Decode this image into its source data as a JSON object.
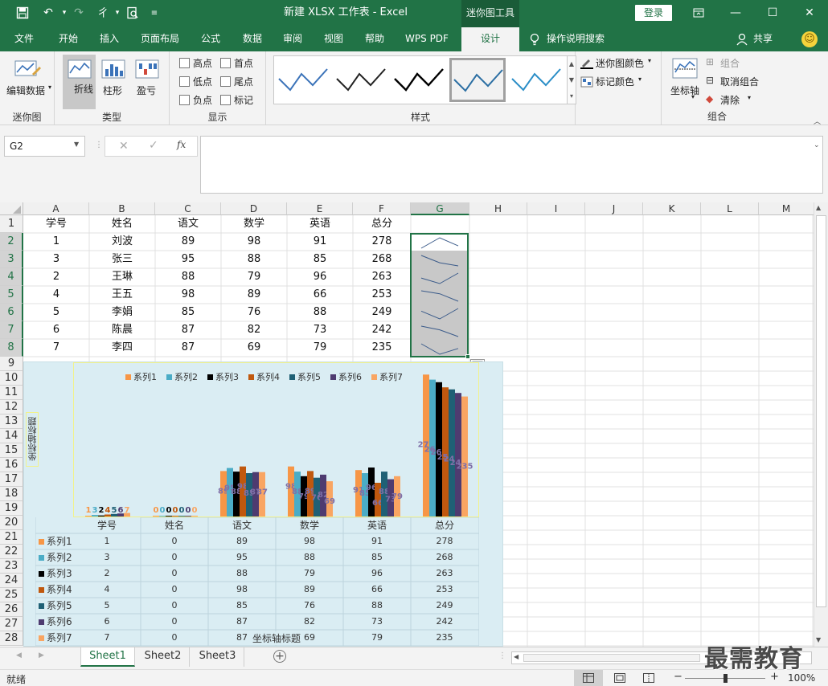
{
  "window": {
    "title": "新建 XLSX 工作表 - Excel",
    "context_tool": "迷你图工具",
    "login": "登录"
  },
  "tabs": [
    "文件",
    "开始",
    "插入",
    "页面布局",
    "公式",
    "数据",
    "审阅",
    "视图",
    "帮助",
    "WPS PDF",
    "设计"
  ],
  "active_tab": "设计",
  "tell_me": "操作说明搜索",
  "share": "共享",
  "ribbon": {
    "edit_data": "编辑数据",
    "group_sparkline": "迷你图",
    "type_line": "折线",
    "type_column": "柱形",
    "type_winloss": "盈亏",
    "group_type": "类型",
    "show": [
      "高点",
      "首点",
      "低点",
      "尾点",
      "负点",
      "标记"
    ],
    "group_show": "显示",
    "group_style": "样式",
    "sparkline_color": "迷你图颜色",
    "marker_color": "标记颜色",
    "axis": "坐标轴",
    "group_label": "组合",
    "ungroup": "取消组合",
    "clear": "清除",
    "group_group": "组合"
  },
  "formula": {
    "name_box": "G2",
    "fx": "fx"
  },
  "columns": [
    "A",
    "B",
    "C",
    "D",
    "E",
    "F",
    "G",
    "H",
    "I",
    "J",
    "K",
    "L",
    "M"
  ],
  "headers": [
    "学号",
    "姓名",
    "语文",
    "数学",
    "英语",
    "总分"
  ],
  "rows": [
    [
      "1",
      "刘波",
      "89",
      "98",
      "91",
      "278"
    ],
    [
      "3",
      "张三",
      "95",
      "88",
      "85",
      "268"
    ],
    [
      "2",
      "王琳",
      "88",
      "79",
      "96",
      "263"
    ],
    [
      "4",
      "王五",
      "98",
      "89",
      "66",
      "253"
    ],
    [
      "5",
      "李娟",
      "85",
      "76",
      "88",
      "249"
    ],
    [
      "6",
      "陈晨",
      "87",
      "82",
      "73",
      "242"
    ],
    [
      "7",
      "李四",
      "87",
      "69",
      "79",
      "235"
    ]
  ],
  "row_numbers": [
    "1",
    "2",
    "3",
    "4",
    "5",
    "6",
    "7",
    "8",
    "9",
    "10",
    "11",
    "12",
    "13",
    "14",
    "15",
    "16",
    "17",
    "18",
    "19",
    "20",
    "21",
    "22",
    "23",
    "24",
    "25",
    "26",
    "27",
    "28"
  ],
  "chart_data": {
    "type": "bar",
    "categories": [
      "学号",
      "姓名",
      "语文",
      "数学",
      "英语",
      "总分"
    ],
    "series": [
      {
        "name": "系列1",
        "values": [
          1,
          0,
          89,
          98,
          91,
          278
        ],
        "color": "#f79646"
      },
      {
        "name": "系列2",
        "values": [
          3,
          0,
          95,
          88,
          85,
          268
        ],
        "color": "#4bacc6"
      },
      {
        "name": "系列3",
        "values": [
          2,
          0,
          88,
          79,
          96,
          263
        ],
        "color": "#000000"
      },
      {
        "name": "系列4",
        "values": [
          4,
          0,
          98,
          89,
          66,
          253
        ],
        "color": "#c0580e"
      },
      {
        "name": "系列5",
        "values": [
          5,
          0,
          85,
          76,
          88,
          249
        ],
        "color": "#1f6075"
      },
      {
        "name": "系列6",
        "values": [
          6,
          0,
          87,
          82,
          73,
          242
        ],
        "color": "#4e3b70"
      },
      {
        "name": "系列7",
        "values": [
          7,
          0,
          87,
          69,
          79,
          235
        ],
        "color": "#f9a562"
      }
    ],
    "ylabel": "坐标轴标题",
    "xlabel": "坐标轴标题",
    "legend": "top",
    "ylim": [
      0,
      280
    ],
    "data_table": true
  },
  "sheets": [
    "Sheet1",
    "Sheet2",
    "Sheet3"
  ],
  "active_sheet": "Sheet1",
  "status": {
    "ready": "就绪",
    "zoom": "100%"
  },
  "watermark": "最需教育"
}
